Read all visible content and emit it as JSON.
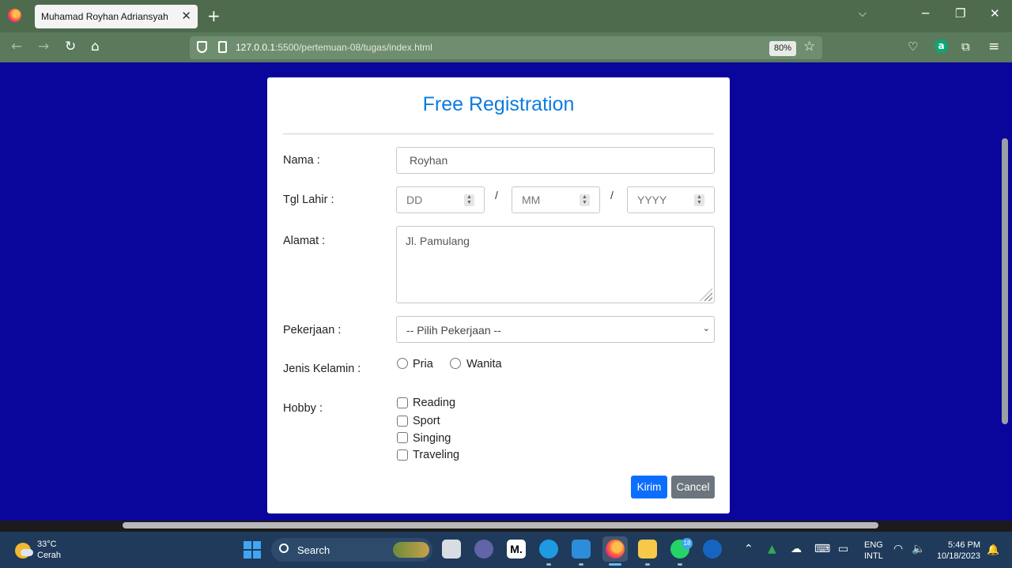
{
  "browser": {
    "tab_title": "Muhamad Royhan Adriansyah",
    "url_host": "127.0.0.1",
    "url_rest": ":5500/pertemuan-08/tugas/index.html",
    "zoom": "80%"
  },
  "form": {
    "title": "Free Registration",
    "nama_label": "Nama :",
    "nama_value": "Royhan",
    "tgl_label": "Tgl Lahir :",
    "dd_placeholder": "DD",
    "mm_placeholder": "MM",
    "yyyy_placeholder": "YYYY",
    "date_sep": "/",
    "alamat_label": "Alamat :",
    "alamat_value": "Jl. Pamulang",
    "pekerjaan_label": "Pekerjaan :",
    "pekerjaan_selected": "-- Pilih Pekerjaan --",
    "gender_label": "Jenis Kelamin :",
    "gender_options": [
      "Pria",
      "Wanita"
    ],
    "hobby_label": "Hobby :",
    "hobbies": [
      "Reading",
      "Sport",
      "Singing",
      "Traveling"
    ],
    "submit_label": "Kirim",
    "cancel_label": "Cancel"
  },
  "taskbar": {
    "temperature": "33°C",
    "weather": "Cerah",
    "search_label": "Search",
    "whatsapp_badge": "18",
    "lang_line1": "ENG",
    "lang_line2": "INTL",
    "time": "5:46 PM",
    "date": "10/18/2023"
  }
}
